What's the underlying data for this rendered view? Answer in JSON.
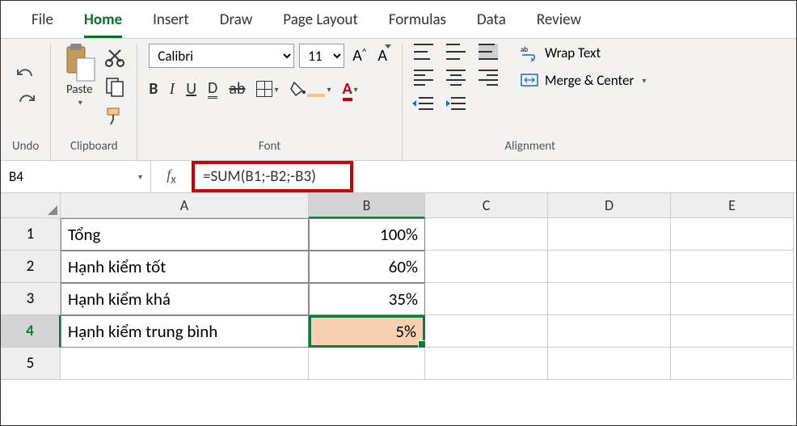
{
  "tabs": [
    "File",
    "Home",
    "Insert",
    "Draw",
    "Page Layout",
    "Formulas",
    "Data",
    "Review"
  ],
  "active_tab": 1,
  "ribbon": {
    "undo_label": "Undo",
    "clipboard_label": "Clipboard",
    "paste_label": "Paste",
    "font_label": "Font",
    "alignment_label": "Alignment",
    "font_name_value": "Calibri",
    "font_size_value": "11",
    "bold": "B",
    "italic": "I",
    "underline": "U",
    "dbl_u": "D",
    "strike": "ab",
    "font_color_letter": "A",
    "wrap_text": "Wrap Text",
    "merge_center": "Merge & Center"
  },
  "name_box": "B4",
  "formula": "=SUM(B1;-B2;-B3)",
  "columns": [
    "A",
    "B",
    "C",
    "D",
    "E"
  ],
  "rows": [
    {
      "n": "1",
      "a": "Tổng",
      "b": "100%"
    },
    {
      "n": "2",
      "a": "Hạnh kiểm tốt",
      "b": "60%"
    },
    {
      "n": "3",
      "a": "Hạnh kiểm khá",
      "b": "35%"
    },
    {
      "n": "4",
      "a": "Hạnh kiểm trung bình",
      "b": "5%"
    },
    {
      "n": "5",
      "a": "",
      "b": ""
    }
  ],
  "selected_cell": "B4"
}
